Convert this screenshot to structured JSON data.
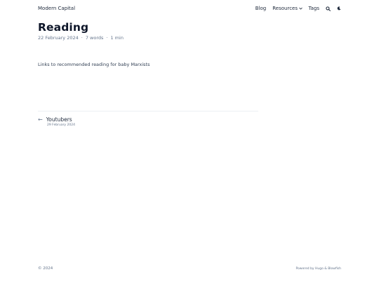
{
  "header": {
    "site_title": "Modern Capital",
    "nav": {
      "blog": "Blog",
      "resources": "Resources",
      "tags": "Tags"
    },
    "icons": [
      "search-icon",
      "moon-icon",
      "chevron-down-icon"
    ]
  },
  "article": {
    "title": "Reading",
    "date": "22 February 2024",
    "sep": "·",
    "words": "7 words",
    "read_time": "1 min",
    "body": "Links to recommended reading for baby Marxists"
  },
  "pagination": {
    "arrow": "←",
    "prev_title": "Youtubers",
    "prev_date": "29 February 2024"
  },
  "footer": {
    "copyright": "© 2024",
    "powered": "Powered by Hugo & Blowfish"
  },
  "colors": {
    "text": "#1e293b",
    "muted": "#64748b",
    "heading": "#0f172a"
  }
}
